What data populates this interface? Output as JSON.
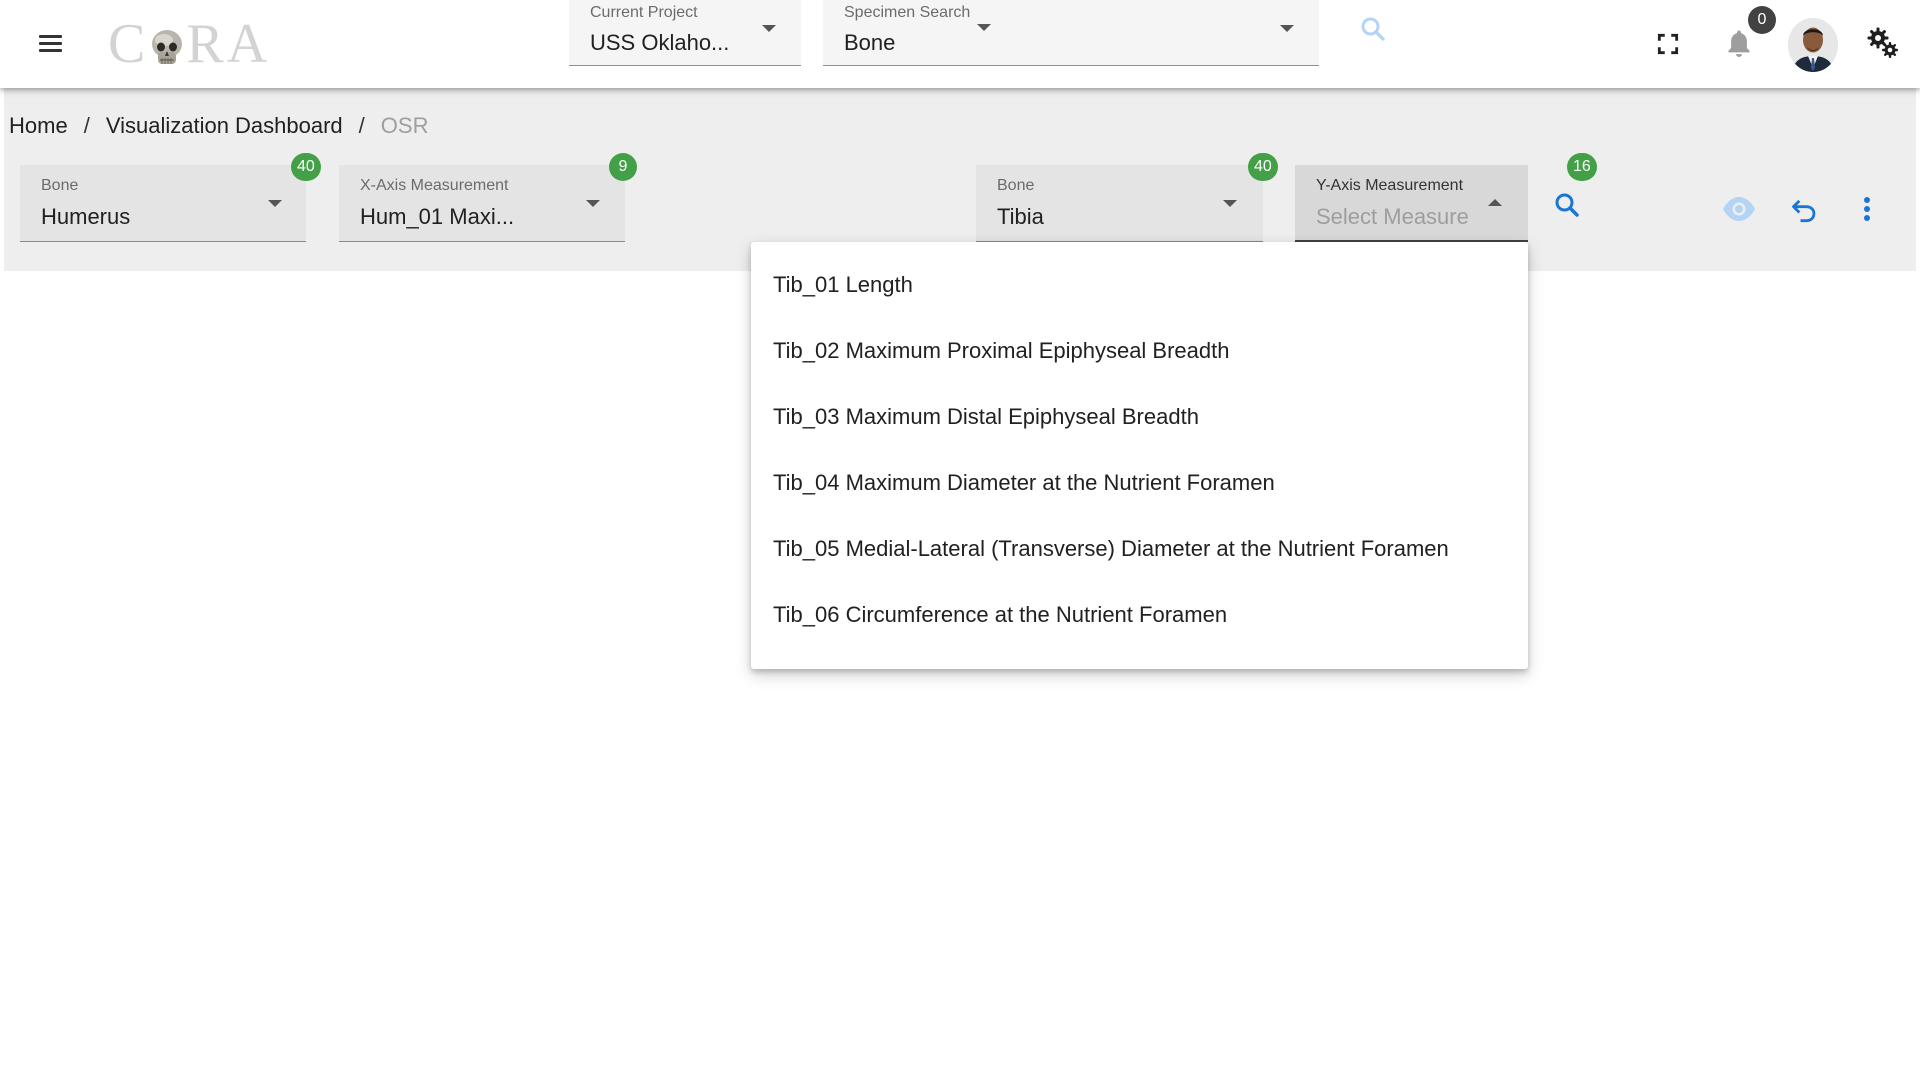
{
  "app": {
    "logo_text_left": "C",
    "logo_text_right": "RA",
    "notifications_count": "0"
  },
  "top_selects": {
    "project": {
      "label": "Current Project",
      "value": "USS Oklaho..."
    },
    "specimen_search": {
      "label": "Specimen Search",
      "value": "Bone"
    }
  },
  "breadcrumb": {
    "home": "Home",
    "separator": "/",
    "dashboard": "Visualization Dashboard",
    "current": "OSR"
  },
  "filters": {
    "x_bone": {
      "label": "Bone",
      "value": "Humerus",
      "count": "40"
    },
    "x_measure": {
      "label": "X-Axis Measurement",
      "value": "Hum_01 Maxi...",
      "count": "9"
    },
    "y_bone": {
      "label": "Bone",
      "value": "Tibia",
      "count": "40"
    },
    "y_measure": {
      "label": "Y-Axis Measurement",
      "placeholder": "Select Measure",
      "count": "16"
    }
  },
  "dropdown": {
    "options": [
      "Tib_01 Length",
      "Tib_02 Maximum Proximal Epiphyseal Breadth",
      "Tib_03 Maximum Distal Epiphyseal Breadth",
      "Tib_04 Maximum Diameter at the Nutrient Foramen",
      "Tib_05 Medial-Lateral (Transverse) Diameter at the Nutrient Foramen",
      "Tib_06 Circumference at the Nutrient Foramen"
    ]
  },
  "colors": {
    "badge_green": "#43a047",
    "accent_blue": "#1976d2",
    "band_gray": "#eeeeee"
  },
  "icons": [
    "menu-icon",
    "skull-icon",
    "search-icon",
    "fullscreen-icon",
    "bell-icon",
    "settings-icon",
    "eye-icon",
    "undo-icon",
    "more-vert-icon"
  ]
}
